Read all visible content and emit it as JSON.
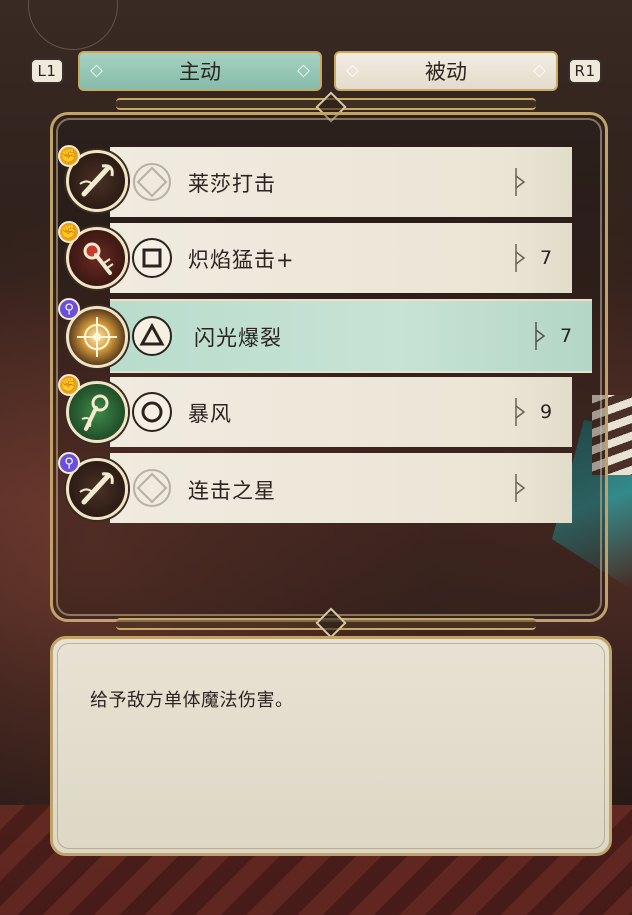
{
  "tabs": {
    "left_shoulder": "L1",
    "right_shoulder": "R1",
    "active_label": "主动",
    "inactive_label": "被动"
  },
  "skills": [
    {
      "name": "莱莎打击",
      "type": "physical",
      "type_icon": "fist-icon",
      "skill_icon": "staff-strike-icon",
      "button": "empty",
      "cost": ""
    },
    {
      "name": "炽焰猛击+",
      "type": "physical",
      "type_icon": "fist-icon",
      "skill_icon": "flame-staff-icon",
      "button": "square",
      "cost": "7"
    },
    {
      "name": "闪光爆裂",
      "type": "magic",
      "type_icon": "wand-icon",
      "skill_icon": "flash-burst-icon",
      "button": "triangle",
      "cost": "7"
    },
    {
      "name": "暴风",
      "type": "physical",
      "type_icon": "fist-icon",
      "skill_icon": "wind-staff-icon",
      "button": "circle",
      "cost": "9"
    },
    {
      "name": "连击之星",
      "type": "magic",
      "type_icon": "wand-icon",
      "skill_icon": "staff-strike-icon",
      "button": "empty",
      "cost": ""
    }
  ],
  "selected_index": 2,
  "description": "给予敌方单体魔法伤害。",
  "colors": {
    "active_tab": "#9ccab9",
    "inactive_tab": "#efe9dc",
    "frame_gold": "#bfa36a",
    "selected_row": "#bfe0d1",
    "physical_badge": "#e8a21c",
    "magic_badge": "#6a4fd8"
  }
}
